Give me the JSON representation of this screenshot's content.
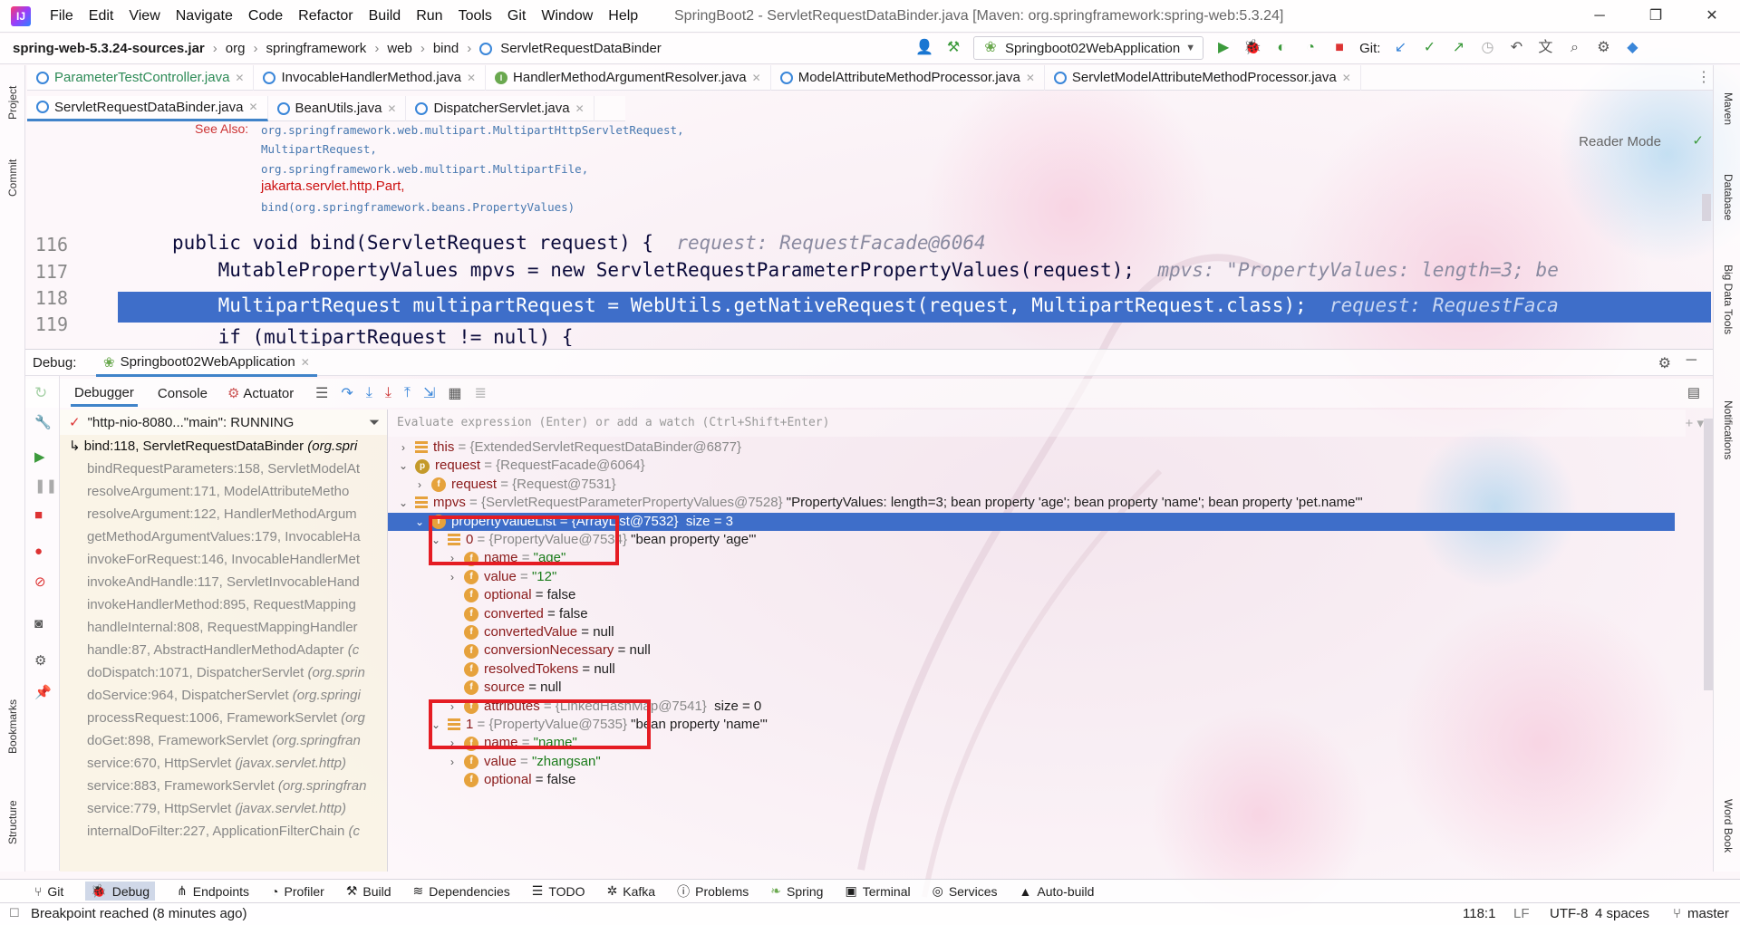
{
  "app": {
    "logo_text": "IJ",
    "menus": [
      "File",
      "Edit",
      "View",
      "Navigate",
      "Code",
      "Refactor",
      "Build",
      "Run",
      "Tools",
      "Git",
      "Window",
      "Help"
    ],
    "window_title": "SpringBoot2 - ServletRequestDataBinder.java [Maven: org.springframework:spring-web:5.3.24]",
    "win_controls": [
      "─",
      "❐",
      "✕"
    ]
  },
  "navbar": {
    "crumbs": [
      "spring-web-5.3.24-sources.jar",
      "org",
      "springframework",
      "web",
      "bind",
      "ServletRequestDataBinder"
    ],
    "run_config": "Springboot02WebApplication",
    "git_label": "Git:"
  },
  "tabs_row1": [
    {
      "label": "ParameterTestController.java",
      "kind": "class",
      "color": "#2e8b57"
    },
    {
      "label": "InvocableHandlerMethod.java",
      "kind": "class",
      "color": "#1e1e1e"
    },
    {
      "label": "HandlerMethodArgumentResolver.java",
      "kind": "interface",
      "color": "#1e1e1e"
    },
    {
      "label": "ModelAttributeMethodProcessor.java",
      "kind": "class",
      "color": "#1e1e1e"
    },
    {
      "label": "ServletModelAttributeMethodProcessor.java",
      "kind": "class",
      "color": "#1e1e1e"
    }
  ],
  "tabs_row2": [
    {
      "label": "ServletRequestDataBinder.java",
      "active": true
    },
    {
      "label": "BeanUtils.java",
      "active": false
    },
    {
      "label": "DispatcherServlet.java",
      "active": false
    }
  ],
  "sidebars": {
    "left": [
      "Project",
      "Commit",
      "Bookmarks",
      "Structure"
    ],
    "right": [
      "Maven",
      "Database",
      "Big Data Tools",
      "Notifications",
      "Word Book"
    ]
  },
  "editor": {
    "reader_mode": "Reader Mode",
    "see_also_label": "See Also:",
    "doc_lines": [
      {
        "text": "org.springframework.web.multipart.MultipartHttpServletRequest,",
        "red": false
      },
      {
        "text": "MultipartRequest,",
        "red": false
      },
      {
        "text": "org.springframework.web.multipart.MultipartFile,",
        "red": false
      },
      {
        "text": "jakarta.servlet.http.Part,",
        "red": true
      },
      {
        "text": "bind(org.springframework.beans.PropertyValues)",
        "red": false
      }
    ],
    "lines": [
      {
        "num": "116",
        "code": "public void bind(ServletRequest request) {",
        "hint": "request: RequestFacade@6064"
      },
      {
        "num": "117",
        "code": "    MutablePropertyValues mpvs = new ServletRequestParameterPropertyValues(request);",
        "hint": "mpvs: \"PropertyValues: length=3; be"
      },
      {
        "num": "118",
        "code": "    MultipartRequest multipartRequest = WebUtils.getNativeRequest(request, MultipartRequest.class);",
        "hint": "request: RequestFaca"
      },
      {
        "num": "119",
        "code": "    if (multipartRequest != null) {",
        "hint": ""
      }
    ]
  },
  "debug": {
    "label": "Debug:",
    "session": "Springboot02WebApplication",
    "tabs": [
      "Debugger",
      "Console",
      "Actuator"
    ],
    "thread": "\"http-nio-8080...\"main\": RUNNING",
    "eval_placeholder": "Evaluate expression (Enter) or add a watch (Ctrl+Shift+Enter)",
    "frames": [
      {
        "text": "bind:118, ServletRequestDataBinder",
        "pkg": "(org.spri",
        "current": true
      },
      {
        "text": "bindRequestParameters:158, ServletModelAt",
        "pkg": "",
        "current": false
      },
      {
        "text": "resolveArgument:171, ModelAttributeMetho",
        "pkg": "",
        "current": false
      },
      {
        "text": "resolveArgument:122, HandlerMethodArgum",
        "pkg": "",
        "current": false
      },
      {
        "text": "getMethodArgumentValues:179, InvocableHa",
        "pkg": "",
        "current": false
      },
      {
        "text": "invokeForRequest:146, InvocableHandlerMet",
        "pkg": "",
        "current": false
      },
      {
        "text": "invokeAndHandle:117, ServletInvocableHand",
        "pkg": "",
        "current": false
      },
      {
        "text": "invokeHandlerMethod:895, RequestMapping",
        "pkg": "",
        "current": false
      },
      {
        "text": "handleInternal:808, RequestMappingHandler",
        "pkg": "",
        "current": false
      },
      {
        "text": "handle:87, AbstractHandlerMethodAdapter",
        "pkg": "(c",
        "current": false
      },
      {
        "text": "doDispatch:1071, DispatcherServlet",
        "pkg": "(org.sprin",
        "current": false
      },
      {
        "text": "doService:964, DispatcherServlet",
        "pkg": "(org.springi",
        "current": false
      },
      {
        "text": "processRequest:1006, FrameworkServlet",
        "pkg": "(org",
        "current": false
      },
      {
        "text": "doGet:898, FrameworkServlet",
        "pkg": "(org.springfran",
        "current": false
      },
      {
        "text": "service:670, HttpServlet",
        "pkg": "(javax.servlet.http)",
        "current": false
      },
      {
        "text": "service:883, FrameworkServlet",
        "pkg": "(org.springfran",
        "current": false
      },
      {
        "text": "service:779, HttpServlet",
        "pkg": "(javax.servlet.http)",
        "current": false
      },
      {
        "text": "internalDoFilter:227, ApplicationFilterChain",
        "pkg": "(c",
        "current": false
      }
    ],
    "vars": [
      {
        "indent": 0,
        "arrow": "›",
        "icon": "list",
        "name": "this",
        "rest": " = {ExtendedServletRequestDataBinder@6877}",
        "str": "",
        "extra": "",
        "sel": false
      },
      {
        "indent": 0,
        "arrow": "⌄",
        "icon": "p",
        "name": "request",
        "rest": " = {RequestFacade@6064}",
        "str": "",
        "extra": "",
        "sel": false
      },
      {
        "indent": 1,
        "arrow": "›",
        "icon": "f",
        "name": "request",
        "rest": " = {Request@7531}",
        "str": "",
        "extra": "",
        "sel": false
      },
      {
        "indent": 0,
        "arrow": "⌄",
        "icon": "list",
        "name": "mpvs",
        "rest": " = {ServletRequestParameterPropertyValues@7528}",
        "str": "",
        "extra": " \"PropertyValues: length=3; bean property 'age'; bean property 'name'; bean property 'pet.name'\"",
        "sel": false
      },
      {
        "indent": 1,
        "arrow": "⌄",
        "icon": "f",
        "name": "propertyValueList",
        "rest": " = {ArrayList@7532}",
        "str": "",
        "extra": "  size = 3",
        "sel": true
      },
      {
        "indent": 2,
        "arrow": "⌄",
        "icon": "list",
        "name": "0",
        "rest": " = {PropertyValue@7534}",
        "str": "",
        "extra": " \"bean property 'age'\"",
        "sel": false
      },
      {
        "indent": 3,
        "arrow": "›",
        "icon": "f",
        "name": "name",
        "rest": " = ",
        "str": "\"age\"",
        "extra": "",
        "sel": false
      },
      {
        "indent": 3,
        "arrow": "›",
        "icon": "f",
        "name": "value",
        "rest": " = ",
        "str": "\"12\"",
        "extra": "",
        "sel": false
      },
      {
        "indent": 3,
        "arrow": "",
        "icon": "f",
        "name": "optional",
        "rest": " = false",
        "str": "",
        "extra": "",
        "sel": false
      },
      {
        "indent": 3,
        "arrow": "",
        "icon": "f",
        "name": "converted",
        "rest": " = false",
        "str": "",
        "extra": "",
        "sel": false
      },
      {
        "indent": 3,
        "arrow": "",
        "icon": "f",
        "name": "convertedValue",
        "rest": " = null",
        "str": "",
        "extra": "",
        "sel": false
      },
      {
        "indent": 3,
        "arrow": "",
        "icon": "f",
        "name": "conversionNecessary",
        "rest": " = null",
        "str": "",
        "extra": "",
        "sel": false
      },
      {
        "indent": 3,
        "arrow": "",
        "icon": "f",
        "name": "resolvedTokens",
        "rest": " = null",
        "str": "",
        "extra": "",
        "sel": false
      },
      {
        "indent": 3,
        "arrow": "",
        "icon": "f",
        "name": "source",
        "rest": " = null",
        "str": "",
        "extra": "",
        "sel": false
      },
      {
        "indent": 3,
        "arrow": "›",
        "icon": "f",
        "name": "attributes",
        "rest": " = {LinkedHashMap@7541}",
        "str": "",
        "extra": "  size = 0",
        "sel": false
      },
      {
        "indent": 2,
        "arrow": "⌄",
        "icon": "list",
        "name": "1",
        "rest": " = {PropertyValue@7535}",
        "str": "",
        "extra": " \"bean property 'name'\"",
        "sel": false
      },
      {
        "indent": 3,
        "arrow": "›",
        "icon": "f",
        "name": "name",
        "rest": " = ",
        "str": "\"name\"",
        "extra": "",
        "sel": false
      },
      {
        "indent": 3,
        "arrow": "›",
        "icon": "f",
        "name": "value",
        "rest": " = ",
        "str": "\"zhangsan\"",
        "extra": "",
        "sel": false
      },
      {
        "indent": 3,
        "arrow": "",
        "icon": "f",
        "name": "optional",
        "rest": " = false",
        "str": "",
        "extra": "",
        "sel": false
      }
    ]
  },
  "toolwindows": [
    "Git",
    "Debug",
    "Endpoints",
    "Profiler",
    "Build",
    "Dependencies",
    "TODO",
    "Kafka",
    "Problems",
    "Spring",
    "Terminal",
    "Services",
    "Auto-build"
  ],
  "status": {
    "message": "Breakpoint reached (8 minutes ago)",
    "position": "118:1",
    "line_sep": "LF",
    "encoding": "UTF-8",
    "indent": "4 spaces",
    "branch": "master"
  },
  "colors": {
    "accent": "#3e6ec9",
    "highlight_box": "#e51c23",
    "keyword": "#0033b3"
  }
}
